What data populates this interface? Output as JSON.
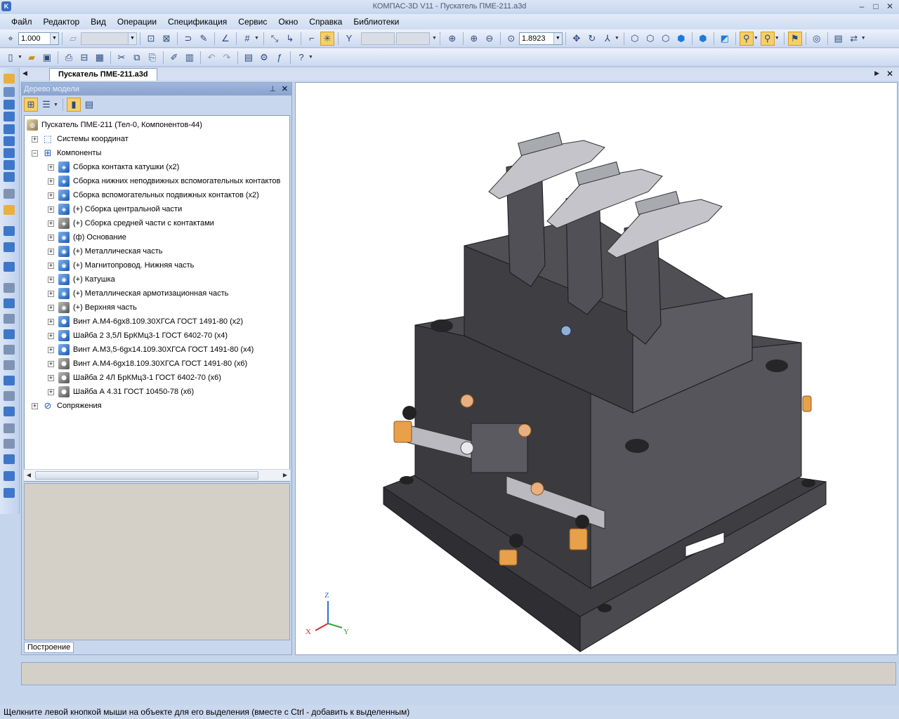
{
  "window": {
    "title": "КОМПАС-3D V11 - Пускатель ПМЕ-211.a3d"
  },
  "menu": {
    "items": [
      "Файл",
      "Редактор",
      "Вид",
      "Операции",
      "Спецификация",
      "Сервис",
      "Окно",
      "Справка",
      "Библиотеки"
    ]
  },
  "toolbar": {
    "step_value": "1.000",
    "zoom_value": "1.8923"
  },
  "document_tab": {
    "label": "Пускатель ПМЕ-211.a3d"
  },
  "model_tree": {
    "panel_title": "Дерево модели",
    "root": "Пускатель ПМЕ-211 (Тел-0, Компонентов-44)",
    "coord_systems": "Системы координат",
    "components": "Компоненты",
    "items": [
      {
        "label": "Сборка контакта катушки (x2)",
        "icon": "assembly-icon",
        "color": "blue"
      },
      {
        "label": "Сборка нижних неподвижных вспомогательных контактов",
        "icon": "assembly-icon",
        "color": "blue"
      },
      {
        "label": "Сборка вспомогательных подвижных контактов (x2)",
        "icon": "assembly-icon",
        "color": "blue"
      },
      {
        "label": "(+) Сборка центральной части",
        "icon": "assembly-icon",
        "color": "blue"
      },
      {
        "label": "(+) Сборка средней части с контактами",
        "icon": "assembly-icon",
        "color": "gray"
      },
      {
        "label": "(ф) Основание",
        "icon": "part-icon",
        "color": "blue"
      },
      {
        "label": "(+) Металлическая часть",
        "icon": "part-icon",
        "color": "blue"
      },
      {
        "label": "(+) Магнитопровод. Нижняя часть",
        "icon": "part-icon",
        "color": "blue"
      },
      {
        "label": "(+) Катушка",
        "icon": "part-icon",
        "color": "blue"
      },
      {
        "label": "(+) Металлическая армотизационная часть",
        "icon": "part-icon",
        "color": "blue"
      },
      {
        "label": "(+) Верхняя часть",
        "icon": "part-icon",
        "color": "gray"
      },
      {
        "label": "Винт А.М4-6gx8.109.30ХГСА ГОСТ 1491-80 (x2)",
        "icon": "standard-part-icon",
        "color": "blue"
      },
      {
        "label": "Шайба 2 3,5Л БрКМц3-1 ГОСТ 6402-70 (x4)",
        "icon": "standard-part-icon",
        "color": "blue"
      },
      {
        "label": "Винт А.М3,5-6gx14.109.30ХГСА ГОСТ 1491-80 (x4)",
        "icon": "standard-part-icon",
        "color": "blue"
      },
      {
        "label": "Винт А.М4-6gx18.109.30ХГСА ГОСТ 1491-80 (x6)",
        "icon": "standard-part-icon",
        "color": "gray"
      },
      {
        "label": "Шайба 2 4Л БрКМц3-1 ГОСТ 6402-70 (x6)",
        "icon": "standard-part-icon",
        "color": "gray"
      },
      {
        "label": "Шайба А 4.31 ГОСТ 10450-78 (x6)",
        "icon": "standard-part-icon",
        "color": "gray"
      }
    ],
    "mates": "Сопряжения",
    "bottom_tab": "Построение"
  },
  "viewport": {
    "axes": {
      "z": "Z",
      "x": "X",
      "y": "Y"
    }
  },
  "status": {
    "hint": "Щелкните левой кнопкой мыши на объекте для его выделения (вместе с Ctrl - добавить к выделенным)"
  },
  "colors": {
    "accent": "#1c58b5",
    "highlight": "#f7cf6a",
    "body": "#4a4a4e",
    "contact": "#e8a04a"
  }
}
